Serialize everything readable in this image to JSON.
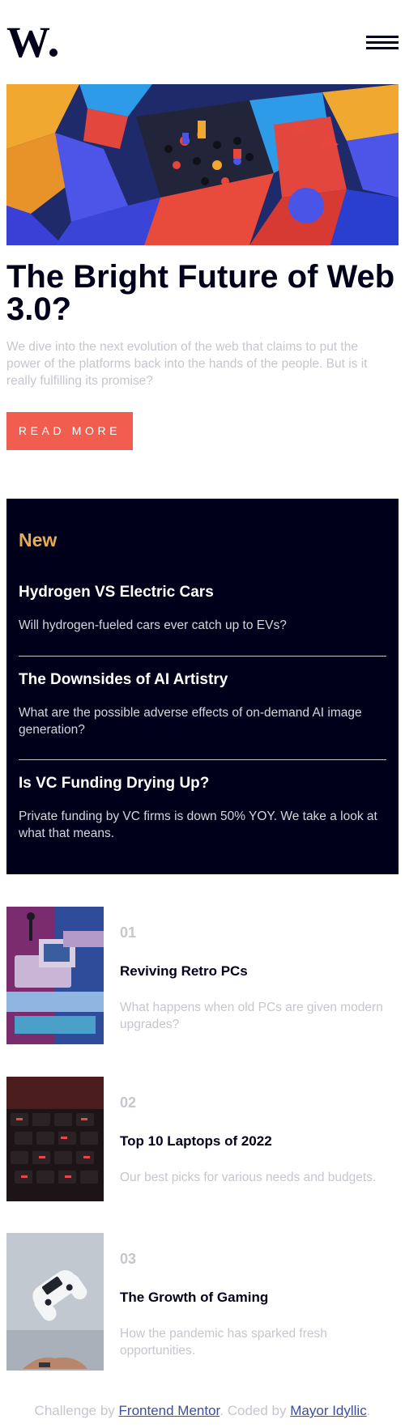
{
  "header": {
    "logo": "W",
    "menu_icon": "hamburger-icon"
  },
  "hero": {
    "image_desc_icon": "abstract-3d-blocks-image",
    "title": "The Bright Future of Web 3.0?",
    "description": "We dive into the next evolution of the web that claims to put the power of the platforms back into the hands of the people. But is it really fulfilling its promise?",
    "button_label": "READ MORE"
  },
  "new_panel": {
    "heading": "New",
    "items": [
      {
        "title": "Hydrogen VS Electric Cars",
        "description": "Will hydrogen-fueled cars ever catch up to EVs?"
      },
      {
        "title": "The Downsides of AI Artistry",
        "description": "What are the possible adverse effects of on-demand AI image generation?"
      },
      {
        "title": "Is VC Funding Drying Up?",
        "description": "Private funding by VC firms is down 50% YOY. We take a look at what that means."
      }
    ]
  },
  "articles": [
    {
      "number": "01",
      "title": "Reviving Retro PCs",
      "description": "What happens when old PCs are given modern upgrades?"
    },
    {
      "number": "02",
      "title": "Top 10 Laptops of 2022",
      "description": "Our best picks for various needs and budgets."
    },
    {
      "number": "03",
      "title": "The Growth of Gaming",
      "description": "How the pandemic has sparked fresh opportunities."
    }
  ],
  "footer": {
    "prefix": "Challenge by",
    "link1": "Frontend Mentor",
    "middle": ". Coded by",
    "link2": "Mayor Idyllic",
    "suffix": "."
  },
  "colors": {
    "accent": "#f15e50",
    "dark_navy": "#00001a",
    "soft_orange": "#e9ab53",
    "grayish_blue": "#c5c6ce"
  }
}
